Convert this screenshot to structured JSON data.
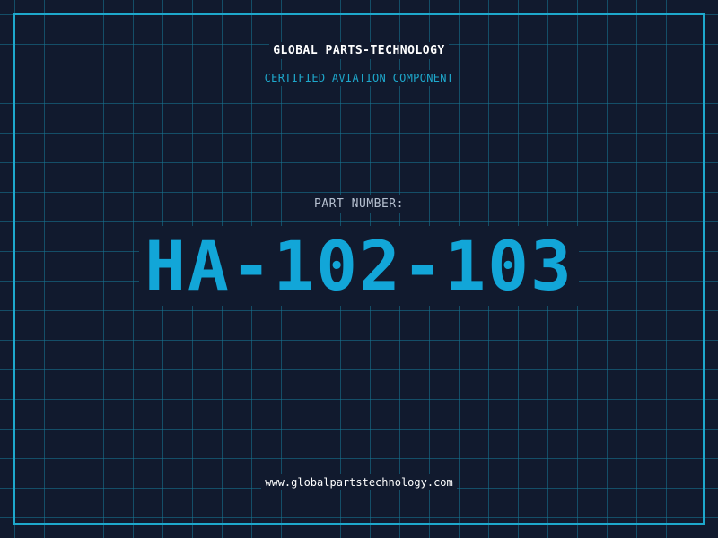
{
  "header": {
    "brand": "GLOBAL PARTS-TECHNOLOGY",
    "subtitle": "CERTIFIED AVIATION COMPONENT"
  },
  "part": {
    "label": "PART NUMBER:",
    "number": "HA-102-103"
  },
  "footer": {
    "url": "www.globalpartstechnology.com"
  },
  "colors": {
    "background": "#111a2e",
    "grid": "#16789a",
    "accent": "#1ea8cc",
    "part_number": "#12a6d8"
  }
}
